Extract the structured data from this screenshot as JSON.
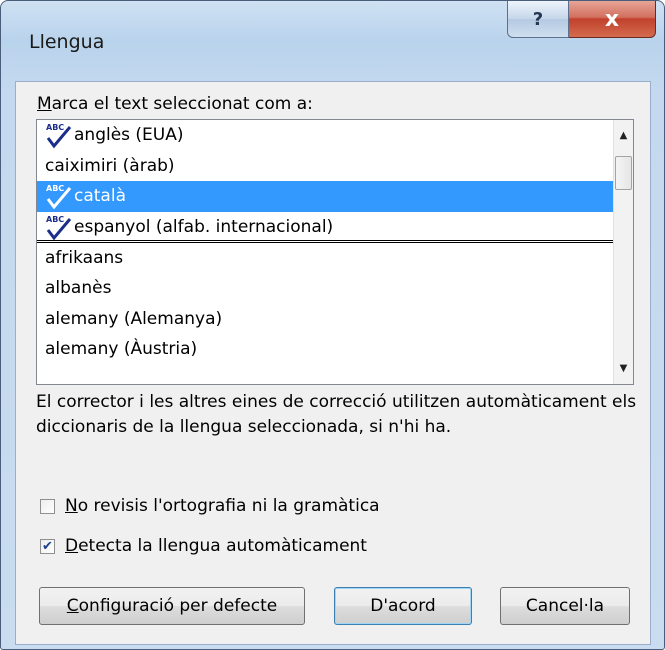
{
  "window": {
    "title": "Llengua",
    "help_glyph": "?",
    "close_glyph": "x"
  },
  "mark_label": {
    "underlined": "M",
    "rest": "arca el text seleccionat com a:"
  },
  "list": {
    "items": [
      {
        "label": "anglès (EUA)",
        "spell_icon": true,
        "selected": false,
        "separator": false
      },
      {
        "label": "caiximiri (àrab)",
        "spell_icon": false,
        "selected": false,
        "separator": false
      },
      {
        "label": "català",
        "spell_icon": true,
        "selected": true,
        "separator": false
      },
      {
        "label": "espanyol (alfab. internacional)",
        "spell_icon": true,
        "selected": false,
        "separator": true
      },
      {
        "label": "afrikaans",
        "spell_icon": false,
        "selected": false,
        "separator": false
      },
      {
        "label": "albanès",
        "spell_icon": false,
        "selected": false,
        "separator": false
      },
      {
        "label": "alemany (Alemanya)",
        "spell_icon": false,
        "selected": false,
        "separator": false
      },
      {
        "label": "alemany (Àustria)",
        "spell_icon": false,
        "selected": false,
        "separator": false
      }
    ]
  },
  "info_text": "El corrector i les altres eines de correcció utilitzen automàticament els diccionaris de la llengua seleccionada, si n'hi ha.",
  "checkboxes": {
    "no_check": {
      "underlined": "N",
      "rest": "o revisis l'ortografia ni la gramàtica",
      "checked": false
    },
    "detect": {
      "underlined": "D",
      "rest": "etecta la llengua automàticament",
      "checked": true
    }
  },
  "buttons": {
    "defaults": {
      "underlined": "C",
      "rest": "onfiguració per defecte"
    },
    "ok": "D'acord",
    "cancel": "Cancel·la"
  },
  "colors": {
    "selection": "#3399ff",
    "check": "#1e3f8a"
  }
}
